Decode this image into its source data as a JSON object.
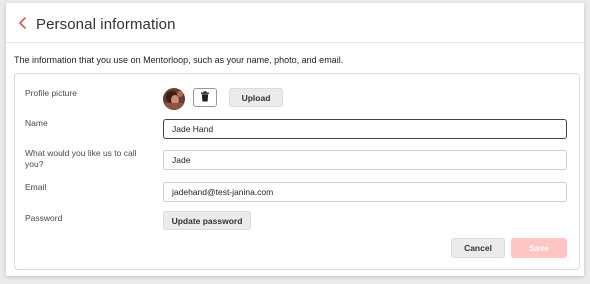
{
  "header": {
    "title": "Personal information"
  },
  "description": "The information that you use on Mentorloop, such as your name, photo, and email.",
  "form": {
    "profile_picture": {
      "label": "Profile picture",
      "upload_label": "Upload"
    },
    "name": {
      "label": "Name",
      "value": "Jade Hand"
    },
    "preferred_name": {
      "label": "What would you like us to call you?",
      "value": "Jade"
    },
    "email": {
      "label": "Email",
      "value": "jadehand@test-janina.com"
    },
    "password": {
      "label": "Password",
      "button_label": "Update password"
    }
  },
  "actions": {
    "cancel_label": "Cancel",
    "save_label": "Save"
  },
  "colors": {
    "accent": "#e2524f",
    "save_disabled_bg": "#ffc4c4",
    "focus_border": "#444444"
  },
  "icons": {
    "back": "chevron-left-icon",
    "delete": "trash-icon"
  }
}
